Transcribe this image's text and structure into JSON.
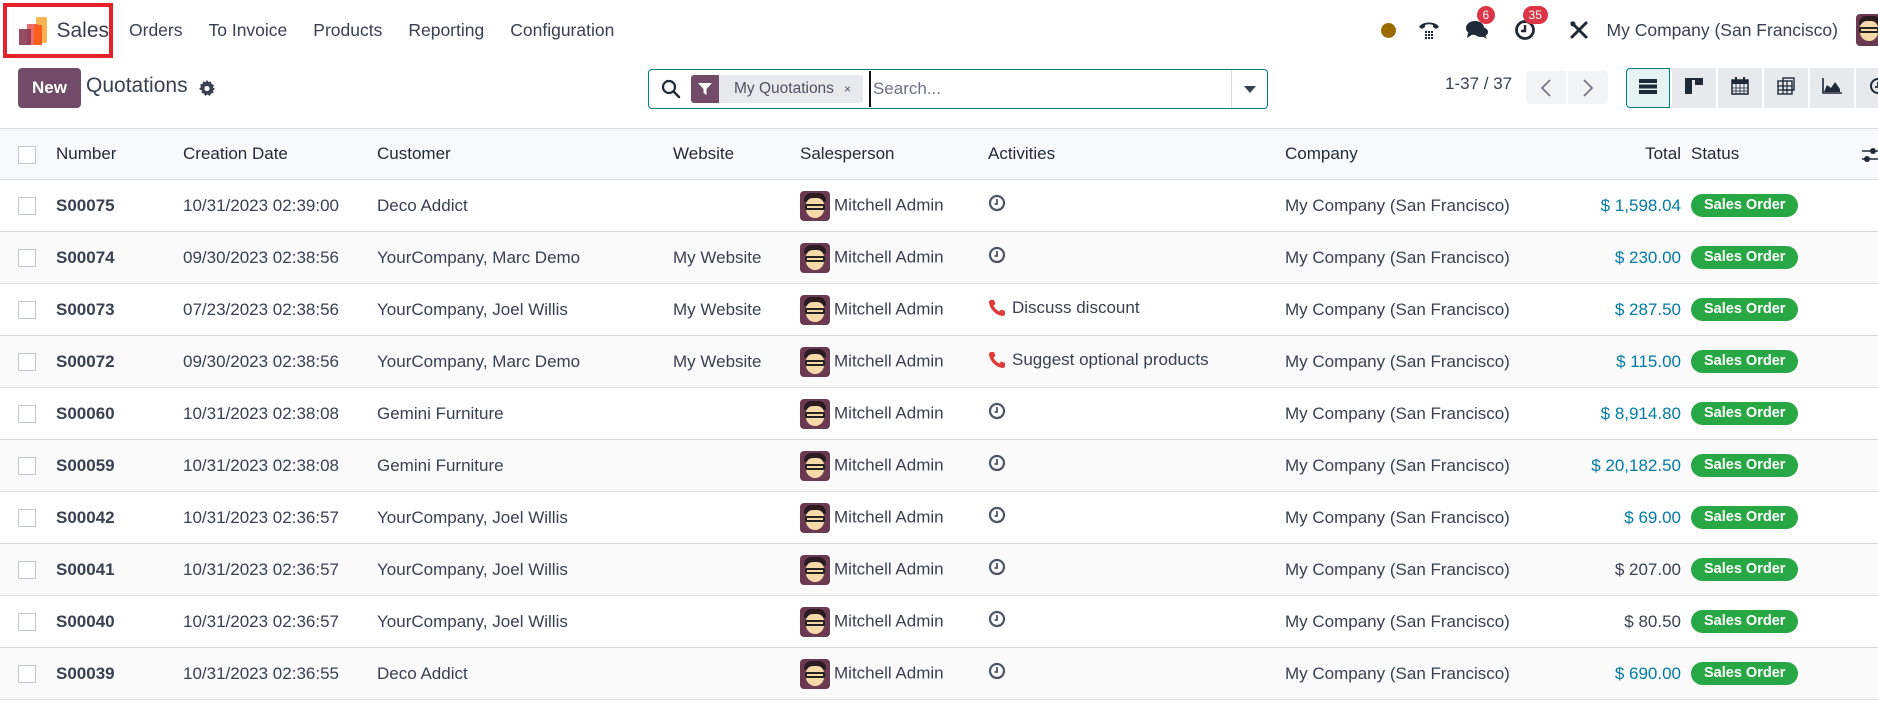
{
  "navbar": {
    "app_name": "Sales",
    "menu": [
      "Orders",
      "To Invoice",
      "Products",
      "Reporting",
      "Configuration"
    ],
    "systray": {
      "status_color": "#9c6b00",
      "messages_badge": "6",
      "activities_badge": "35",
      "company": "My Company (San Francisco)"
    }
  },
  "control_panel": {
    "new_label": "New",
    "title": "Quotations",
    "search": {
      "facet_label": "My Quotations",
      "facet_remove": "×",
      "placeholder": "Search..."
    },
    "pager": {
      "text": "1-37 / 37",
      "prev": "‹",
      "next": "›"
    },
    "views": [
      "list-view",
      "kanban-view",
      "calendar-view",
      "pivot-view",
      "graph-view",
      "activity-view"
    ],
    "active_view": "list-view"
  },
  "table": {
    "columns": [
      "Number",
      "Creation Date",
      "Customer",
      "Website",
      "Salesperson",
      "Activities",
      "Company",
      "Total",
      "Status"
    ],
    "rows": [
      {
        "number": "S00075",
        "date": "10/31/2023 02:39:00",
        "customer": "Deco Addict",
        "website": "",
        "salesperson": "Mitchell Admin",
        "activity_type": "clock",
        "activity": "",
        "company": "My Company (San Francisco)",
        "total": "$ 1,598.04",
        "total_color": "blue",
        "status": "Sales Order"
      },
      {
        "number": "S00074",
        "date": "09/30/2023 02:38:56",
        "customer": "YourCompany, Marc Demo",
        "website": "My Website",
        "salesperson": "Mitchell Admin",
        "activity_type": "clock",
        "activity": "",
        "company": "My Company (San Francisco)",
        "total": "$ 230.00",
        "total_color": "blue",
        "status": "Sales Order"
      },
      {
        "number": "S00073",
        "date": "07/23/2023 02:38:56",
        "customer": "YourCompany, Joel Willis",
        "website": "My Website",
        "salesperson": "Mitchell Admin",
        "activity_type": "phone",
        "activity": "Discuss discount",
        "company": "My Company (San Francisco)",
        "total": "$ 287.50",
        "total_color": "blue",
        "status": "Sales Order"
      },
      {
        "number": "S00072",
        "date": "09/30/2023 02:38:56",
        "customer": "YourCompany, Marc Demo",
        "website": "My Website",
        "salesperson": "Mitchell Admin",
        "activity_type": "phone",
        "activity": "Suggest optional products",
        "company": "My Company (San Francisco)",
        "total": "$ 115.00",
        "total_color": "blue",
        "status": "Sales Order"
      },
      {
        "number": "S00060",
        "date": "10/31/2023 02:38:08",
        "customer": "Gemini Furniture",
        "website": "",
        "salesperson": "Mitchell Admin",
        "activity_type": "clock",
        "activity": "",
        "company": "My Company (San Francisco)",
        "total": "$ 8,914.80",
        "total_color": "blue",
        "status": "Sales Order"
      },
      {
        "number": "S00059",
        "date": "10/31/2023 02:38:08",
        "customer": "Gemini Furniture",
        "website": "",
        "salesperson": "Mitchell Admin",
        "activity_type": "clock",
        "activity": "",
        "company": "My Company (San Francisco)",
        "total": "$ 20,182.50",
        "total_color": "blue",
        "status": "Sales Order"
      },
      {
        "number": "S00042",
        "date": "10/31/2023 02:36:57",
        "customer": "YourCompany, Joel Willis",
        "website": "",
        "salesperson": "Mitchell Admin",
        "activity_type": "clock",
        "activity": "",
        "company": "My Company (San Francisco)",
        "total": "$ 69.00",
        "total_color": "blue",
        "status": "Sales Order"
      },
      {
        "number": "S00041",
        "date": "10/31/2023 02:36:57",
        "customer": "YourCompany, Joel Willis",
        "website": "",
        "salesperson": "Mitchell Admin",
        "activity_type": "clock",
        "activity": "",
        "company": "My Company (San Francisco)",
        "total": "$ 207.00",
        "total_color": "dark",
        "status": "Sales Order"
      },
      {
        "number": "S00040",
        "date": "10/31/2023 02:36:57",
        "customer": "YourCompany, Joel Willis",
        "website": "",
        "salesperson": "Mitchell Admin",
        "activity_type": "clock",
        "activity": "",
        "company": "My Company (San Francisco)",
        "total": "$ 80.50",
        "total_color": "dark",
        "status": "Sales Order"
      },
      {
        "number": "S00039",
        "date": "10/31/2023 02:36:55",
        "customer": "Deco Addict",
        "website": "",
        "salesperson": "Mitchell Admin",
        "activity_type": "clock",
        "activity": "",
        "company": "My Company (San Francisco)",
        "total": "$ 690.00",
        "total_color": "blue",
        "status": "Sales Order"
      }
    ]
  },
  "colors": {
    "brand": "#714b67",
    "accent": "#017e84",
    "status_green": "#28a745",
    "badge_red": "#dc3545",
    "link_blue": "#017aa4",
    "highlight_box": "#e5212a",
    "phone_red": "#e03b3b"
  }
}
